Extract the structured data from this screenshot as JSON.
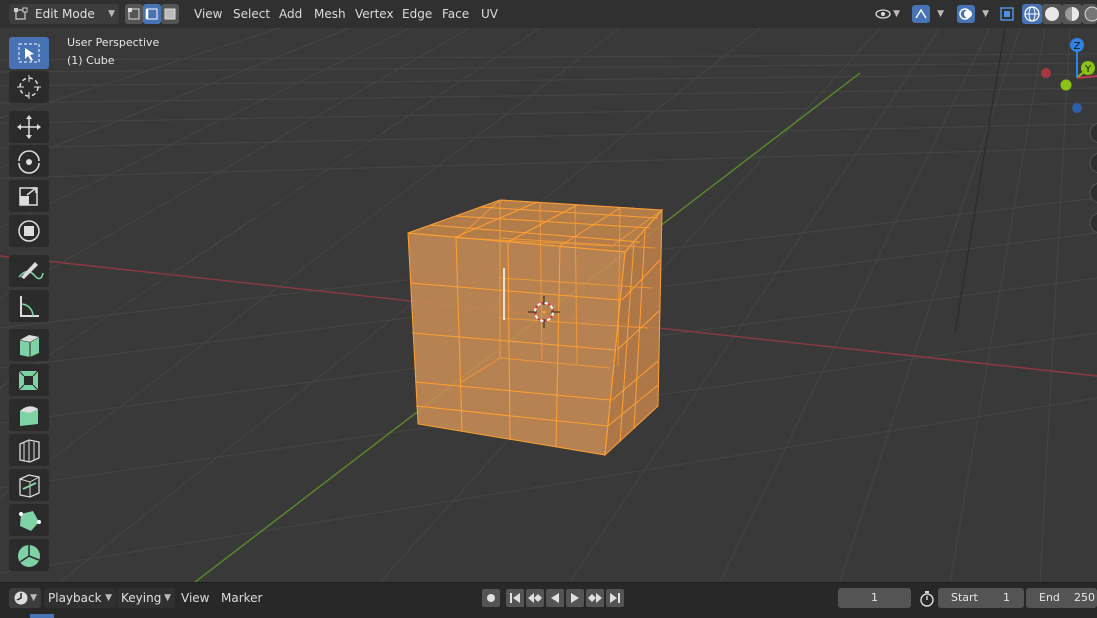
{
  "header": {
    "mode_label": "Edit Mode",
    "menus": [
      "View",
      "Select",
      "Add",
      "Mesh",
      "Vertex",
      "Edge",
      "Face",
      "UV"
    ]
  },
  "viewport": {
    "perspective_label": "User Perspective",
    "object_label": "(1) Cube",
    "gizmo": {
      "z": "Z",
      "y": "Y"
    }
  },
  "tools": [
    "select-box-tool",
    "cursor-tool",
    "move-tool",
    "rotate-tool",
    "scale-tool",
    "transform-tool",
    "annotate-tool",
    "measure-tool",
    "add-cube-tool",
    "extrude-region-tool",
    "inset-faces-tool",
    "bevel-tool",
    "loop-cut-tool",
    "knife-tool",
    "poly-build-tool",
    "spin-tool"
  ],
  "timeline": {
    "playback_label": "Playback",
    "keying_label": "Keying",
    "view_label": "View",
    "marker_label": "Marker",
    "current_frame": "1",
    "start_label": "Start",
    "start_value": "1",
    "end_label": "End",
    "end_value": "250"
  },
  "colors": {
    "accent": "#4772b3",
    "selection": "#ffa033",
    "x_axis": "#a8383f",
    "y_axis": "#6d9b2e",
    "gizmo_x": "#c13849",
    "gizmo_y": "#8bc312",
    "gizmo_z": "#2f84e3"
  }
}
